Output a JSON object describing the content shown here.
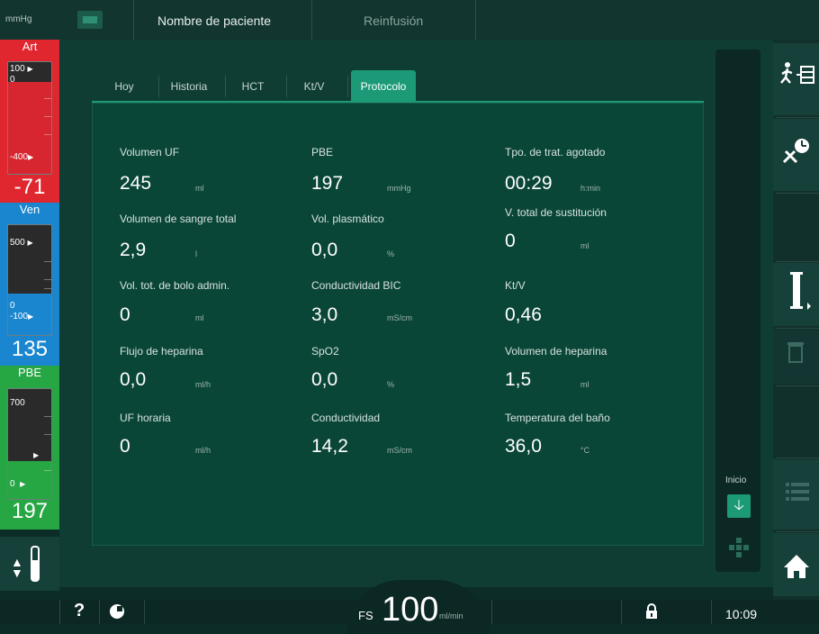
{
  "topbar": {
    "unit": "mmHg",
    "patient_name": "Nombre de paciente",
    "mode": "Reinfusión"
  },
  "pressures": {
    "art": {
      "label": "Art",
      "upper": "100",
      "zero": "0",
      "lower": "-400",
      "value": "-71",
      "color": "#e0262f"
    },
    "ven": {
      "label": "Ven",
      "upper": "500",
      "zero": "0",
      "lower": "-100",
      "value": "135",
      "color": "#1a86cf"
    },
    "pbe": {
      "label": "PBE",
      "upper": "700",
      "zero": "0",
      "value": "197",
      "color": "#27a644"
    }
  },
  "tabs": [
    {
      "label": "Hoy"
    },
    {
      "label": "Historia"
    },
    {
      "label": "HCT"
    },
    {
      "label": "Kt/V"
    },
    {
      "label": "Protocolo",
      "active": true
    }
  ],
  "params": {
    "col1": [
      {
        "label": "Volumen UF",
        "value": "245",
        "unit": "ml"
      },
      {
        "label": "Volumen de sangre total",
        "value": "2,9",
        "unit": "l"
      },
      {
        "label": "Vol. tot. de bolo admin.",
        "value": "0",
        "unit": "ml"
      },
      {
        "label": "Flujo de heparina",
        "value": "0,0",
        "unit": "ml/h"
      },
      {
        "label": "UF horaria",
        "value": "0",
        "unit": "ml/h"
      }
    ],
    "col2": [
      {
        "label": "PBE",
        "value": "197",
        "unit": "mmHg"
      },
      {
        "label": "Vol. plasmático",
        "value": "0,0",
        "unit": "%"
      },
      {
        "label": "Conductividad BIC",
        "value": "3,0",
        "unit": "mS/cm"
      },
      {
        "label": "SpO2",
        "value": "0,0",
        "unit": "%"
      },
      {
        "label": "Conductividad",
        "value": "14,2",
        "unit": "mS/cm"
      }
    ],
    "col3": [
      {
        "label": "Tpo. de trat. agotado",
        "value": "00:29",
        "unit": "h:min"
      },
      {
        "label": "V. total de sustitución",
        "value": "0",
        "unit": "ml"
      },
      {
        "label": "Kt/V",
        "value": "0,46",
        "unit": ""
      },
      {
        "label": "Volumen de heparina",
        "value": "1,5",
        "unit": "ml"
      },
      {
        "label": "Temperatura del baño",
        "value": "36,0",
        "unit": "°C"
      }
    ]
  },
  "scroll": {
    "start_label": "Inicio"
  },
  "bottombar": {
    "help": "?",
    "fs_label": "FS",
    "fs_value": "100",
    "fs_unit": "ml/min",
    "time": "10:09"
  },
  "colors": {
    "accent": "#1c9a78",
    "panel": "#0a4637"
  }
}
